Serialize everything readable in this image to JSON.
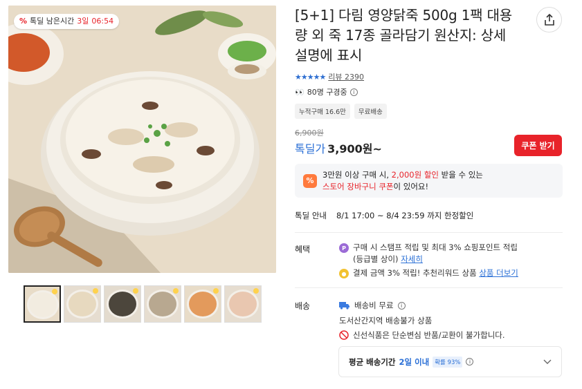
{
  "timer": {
    "label": "톡딜 남은시간",
    "days": "3일",
    "time": "06:54"
  },
  "thumbnails": [
    1,
    2,
    3,
    4,
    5,
    6
  ],
  "product": {
    "title": "[5+1] 다림 영양닭죽 500g 1팩 대용량 외 죽 17종 골라담기 원산지: 상세설명에 표시",
    "stars": "★★★★★",
    "review_link": "리뷰 2390",
    "viewing": "80명 구경중",
    "chips": [
      "누적구매 16.6만",
      "무료배송"
    ],
    "old_price": "6,900원",
    "price_label": "톡딜가",
    "price": "3,900원~",
    "coupon_button": "쿠폰 받기"
  },
  "promo": {
    "line1_a": "3만원 이상 구매 시, ",
    "line1_red": "2,000원 할인",
    "line1_b": " 받을 수 있는",
    "line2_red": "스토어 장바구니 쿠폰",
    "line2_b": "이 있어요!"
  },
  "sale": {
    "label": "톡딜 안내",
    "value": "8/1 17:00 ~ 8/4 23:59 까지 한정할인"
  },
  "benefits": {
    "label": "혜택",
    "item1_a": "구매 시 스탬프 적립 및 최대 3% 쇼핑포인트 적립",
    "item1_b": "(등급별 상이) ",
    "item1_link": "자세히",
    "item2_a": "결제 금액 3% 적립! 추천리워드 상품 ",
    "item2_link": "상품 더보기"
  },
  "shipping": {
    "label": "배송",
    "fee": "배송비 무료",
    "region": "도서산간지역 배송불가 상품",
    "notice": "신선식품은 단순변심 반품/교환이 불가합니다.",
    "avg_label": "평균 배송기간",
    "avg_value": "2일 이내",
    "avg_tag": "확률 93%"
  },
  "colors": {
    "accent": "#e8232a",
    "blue": "#2a6fd6"
  }
}
